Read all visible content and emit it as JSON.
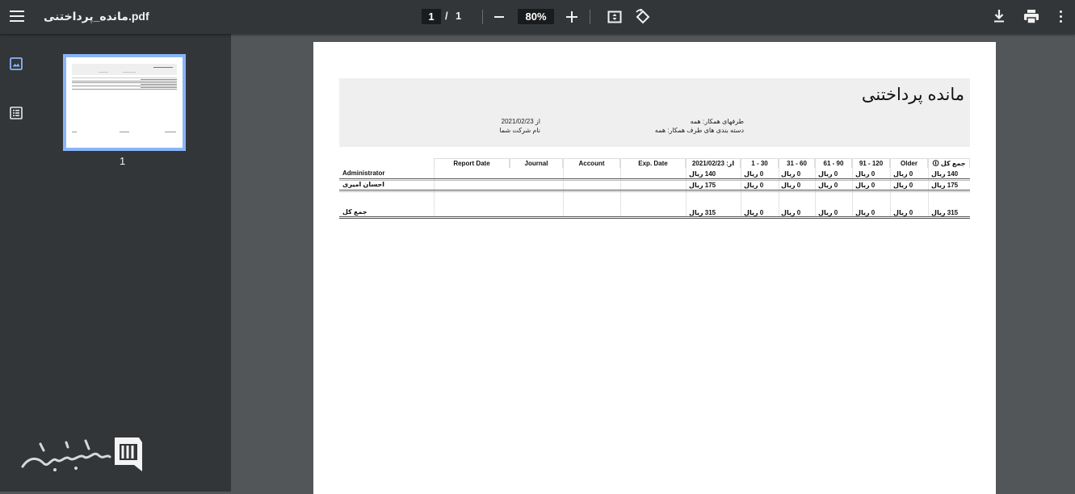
{
  "toolbar": {
    "filename": "مانده_پرداختنی.pdf",
    "current_page": "1",
    "page_separator": "/",
    "total_pages": "1",
    "zoom": "80%"
  },
  "sidebar": {
    "thumbnail_label": "1"
  },
  "report": {
    "title": "مانده پرداختنی",
    "partners_label": "طرفهای همکار: همه",
    "partner_categories_label": "دسته بندی های طرف همکار: همه",
    "from_label": "از 2021/02/23",
    "company_label": "نام شرکت شما",
    "columns": [
      "جمع کل 🛈",
      "Older",
      "91 - 120",
      "61 - 90",
      "31 - 60",
      "1 - 30",
      "از: 2021/02/23",
      "Exp. Date",
      "Account",
      "Journal",
      "Report Date"
    ],
    "rows": [
      {
        "label": "Administrator",
        "values": [
          "140 ریال",
          "0 ریال",
          "0 ریال",
          "0 ریال",
          "0 ریال",
          "0 ریال",
          "140 ریال"
        ]
      },
      {
        "label": "احسان امیری",
        "values": [
          "175 ریال",
          "0 ریال",
          "0 ریال",
          "0 ریال",
          "0 ریال",
          "0 ریال",
          "175 ریال"
        ]
      }
    ],
    "total": {
      "label": "جمع کل",
      "values": [
        "315 ریال",
        "0 ریال",
        "0 ریال",
        "0 ریال",
        "0 ریال",
        "0 ریال",
        "315 ریال"
      ]
    }
  }
}
